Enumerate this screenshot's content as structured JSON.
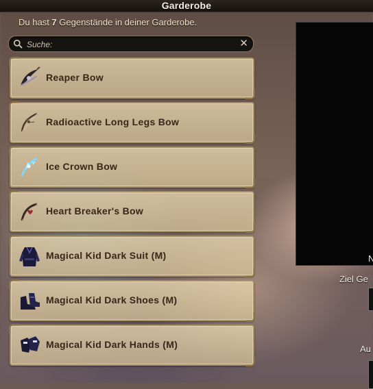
{
  "window": {
    "title": "Garderobe"
  },
  "summary": {
    "prefix": "Du hast ",
    "count": "7",
    "suffix": " Gegenstände in deiner Garderobe."
  },
  "search": {
    "placeholder": "Suche:",
    "value": ""
  },
  "items": [
    {
      "label": "Reaper Bow",
      "icon": "reaper-bow-icon"
    },
    {
      "label": "Radioactive Long Legs Bow",
      "icon": "radioactive-bow-icon"
    },
    {
      "label": "Ice Crown Bow",
      "icon": "ice-crown-bow-icon"
    },
    {
      "label": "Heart Breaker's Bow",
      "icon": "heart-breaker-bow-icon"
    },
    {
      "label": "Magical Kid Dark Suit (M)",
      "icon": "dark-suit-icon"
    },
    {
      "label": "Magical Kid Dark Shoes (M)",
      "icon": "dark-shoes-icon"
    },
    {
      "label": "Magical Kid Dark Hands (M)",
      "icon": "dark-hands-icon"
    }
  ],
  "preview": {
    "corner_label": "N"
  },
  "right_panel": {
    "target_label": "Ziel Ge",
    "bottom_label": "Au"
  },
  "colors": {
    "panel": "#d9c398",
    "border": "#a89068",
    "text": "#3b2516",
    "preview_bg": "#050505"
  }
}
